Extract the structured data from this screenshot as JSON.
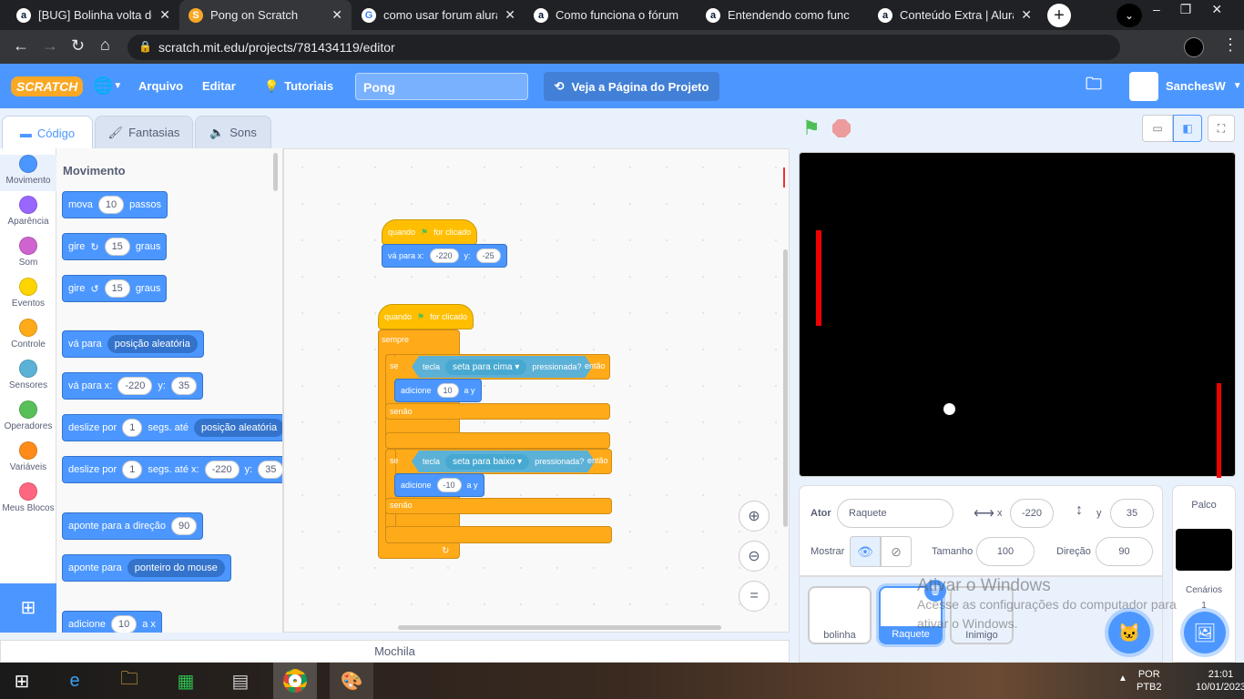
{
  "browser": {
    "tabs": [
      {
        "label": "[BUG] Bolinha volta do",
        "icon": "alura-icon"
      },
      {
        "label": "Pong on Scratch",
        "icon": "scratch-icon",
        "active": true
      },
      {
        "label": "como usar forum alura",
        "icon": "google-icon"
      },
      {
        "label": "Como funciona o fórum",
        "icon": "alura-icon"
      },
      {
        "label": "Entendendo como func",
        "icon": "alura-icon"
      },
      {
        "label": "Conteúdo Extra | Alura",
        "icon": "alura-icon"
      }
    ],
    "url": "scratch.mit.edu/projects/781434119/editor"
  },
  "menu": {
    "logo": "SCRATCH",
    "file": "Arquivo",
    "edit": "Editar",
    "tutorials": "Tutoriais",
    "project_title": "Pong",
    "project_page": "Veja a Página do Projeto",
    "user": "SanchesW"
  },
  "editor_tabs": {
    "code": "Código",
    "costumes": "Fantasias",
    "sounds": "Sons"
  },
  "categories": [
    {
      "label": "Movimento",
      "color": "#4c97ff"
    },
    {
      "label": "Aparência",
      "color": "#9966ff"
    },
    {
      "label": "Som",
      "color": "#cf63cf"
    },
    {
      "label": "Eventos",
      "color": "#ffd500"
    },
    {
      "label": "Controle",
      "color": "#ffab19"
    },
    {
      "label": "Sensores",
      "color": "#5cb1d6"
    },
    {
      "label": "Operadores",
      "color": "#59c059"
    },
    {
      "label": "Variáveis",
      "color": "#ff8c1a"
    },
    {
      "label": "Meus Blocos",
      "color": "#ff6680"
    }
  ],
  "palette": {
    "heading": "Movimento",
    "move": {
      "a": "mova",
      "v": "10",
      "b": "passos"
    },
    "turn_right": {
      "a": "gire",
      "v": "15",
      "b": "graus"
    },
    "turn_left": {
      "a": "gire",
      "v": "15",
      "b": "graus"
    },
    "goto": {
      "a": "vá para",
      "d": "posição aleatória"
    },
    "gotoxy": {
      "a": "vá para x:",
      "x": "-220",
      "b": "y:",
      "y": "35"
    },
    "glide": {
      "a": "deslize por",
      "v": "1",
      "b": "segs. até",
      "d": "posição aleatória"
    },
    "glidexy": {
      "a": "deslize por",
      "v": "1",
      "b": "segs. até x:",
      "x": "-220",
      "c": "y:",
      "y": "35"
    },
    "point_dir": {
      "a": "aponte para a direção",
      "v": "90"
    },
    "point_to": {
      "a": "aponte para",
      "d": "ponteiro do mouse"
    },
    "change_x": {
      "a": "adicione",
      "v": "10",
      "b": "a x"
    }
  },
  "scripts": {
    "s1": {
      "hat_a": "quando",
      "hat_b": "for clicado",
      "goto_a": "vá para x:",
      "x": "-220",
      "goto_b": "y:",
      "y": "-25"
    },
    "s2": {
      "hat_a": "quando",
      "hat_b": "for clicado",
      "forever": "sempre",
      "if1": {
        "se": "se",
        "key_a": "tecla",
        "key": "seta para cima",
        "key_b": "pressionada?",
        "then": "então",
        "change_a": "adicione",
        "v": "10",
        "change_b": "a y",
        "else": "senão"
      },
      "if2": {
        "se": "se",
        "key_a": "tecla",
        "key": "seta para baixo",
        "key_b": "pressionada?",
        "then": "então",
        "change_a": "adicione",
        "v": "-10",
        "change_b": "a y",
        "else": "senão"
      }
    }
  },
  "backpack": "Mochila",
  "sprite_info": {
    "actor_label": "Ator",
    "actor": "Raquete",
    "x_label": "x",
    "x": "-220",
    "y_label": "y",
    "y": "35",
    "show_label": "Mostrar",
    "size_label": "Tamanho",
    "size": "100",
    "dir_label": "Direção",
    "dir": "90"
  },
  "sprites": [
    {
      "name": "bolinha"
    },
    {
      "name": "Raquete",
      "selected": true
    },
    {
      "name": "Inimigo"
    }
  ],
  "stage_pane": {
    "title": "Palco",
    "backdrops_label": "Cenários",
    "backdrops": "1"
  },
  "watermark": {
    "title": "Ativar o Windows",
    "line1": "Acesse as configurações do computador para",
    "line2": "ativar o Windows."
  },
  "taskbar": {
    "lang1": "POR",
    "lang2": "PTB2",
    "time": "21:01",
    "date": "10/01/2023"
  }
}
